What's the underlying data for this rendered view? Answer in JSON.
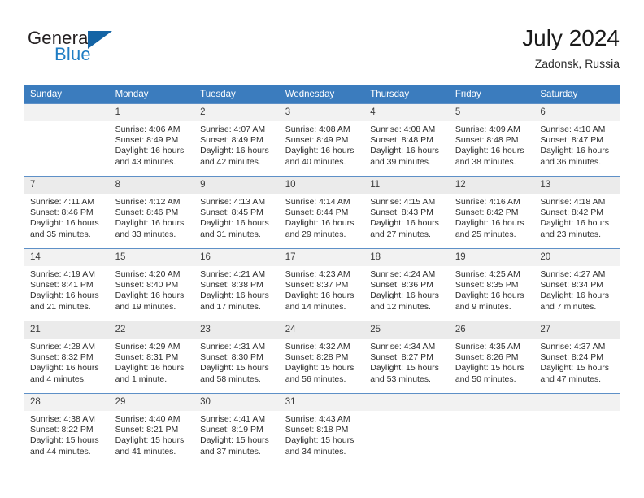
{
  "brand": {
    "word_one": "General",
    "word_two": "Blue",
    "triangle_icon": "triangle-icon",
    "accent_color": "#1464a5"
  },
  "header": {
    "title": "July 2024",
    "subtitle": "Zadonsk, Russia"
  },
  "calendar": {
    "header_color": "#3b7cbe",
    "weekdays": [
      "Sunday",
      "Monday",
      "Tuesday",
      "Wednesday",
      "Thursday",
      "Friday",
      "Saturday"
    ],
    "weeks": [
      [
        {
          "day": "",
          "sunrise": "",
          "sunset": "",
          "daylight_1": "",
          "daylight_2": ""
        },
        {
          "day": "1",
          "sunrise": "Sunrise: 4:06 AM",
          "sunset": "Sunset: 8:49 PM",
          "daylight_1": "Daylight: 16 hours",
          "daylight_2": "and 43 minutes."
        },
        {
          "day": "2",
          "sunrise": "Sunrise: 4:07 AM",
          "sunset": "Sunset: 8:49 PM",
          "daylight_1": "Daylight: 16 hours",
          "daylight_2": "and 42 minutes."
        },
        {
          "day": "3",
          "sunrise": "Sunrise: 4:08 AM",
          "sunset": "Sunset: 8:49 PM",
          "daylight_1": "Daylight: 16 hours",
          "daylight_2": "and 40 minutes."
        },
        {
          "day": "4",
          "sunrise": "Sunrise: 4:08 AM",
          "sunset": "Sunset: 8:48 PM",
          "daylight_1": "Daylight: 16 hours",
          "daylight_2": "and 39 minutes."
        },
        {
          "day": "5",
          "sunrise": "Sunrise: 4:09 AM",
          "sunset": "Sunset: 8:48 PM",
          "daylight_1": "Daylight: 16 hours",
          "daylight_2": "and 38 minutes."
        },
        {
          "day": "6",
          "sunrise": "Sunrise: 4:10 AM",
          "sunset": "Sunset: 8:47 PM",
          "daylight_1": "Daylight: 16 hours",
          "daylight_2": "and 36 minutes."
        }
      ],
      [
        {
          "day": "7",
          "sunrise": "Sunrise: 4:11 AM",
          "sunset": "Sunset: 8:46 PM",
          "daylight_1": "Daylight: 16 hours",
          "daylight_2": "and 35 minutes."
        },
        {
          "day": "8",
          "sunrise": "Sunrise: 4:12 AM",
          "sunset": "Sunset: 8:46 PM",
          "daylight_1": "Daylight: 16 hours",
          "daylight_2": "and 33 minutes."
        },
        {
          "day": "9",
          "sunrise": "Sunrise: 4:13 AM",
          "sunset": "Sunset: 8:45 PM",
          "daylight_1": "Daylight: 16 hours",
          "daylight_2": "and 31 minutes."
        },
        {
          "day": "10",
          "sunrise": "Sunrise: 4:14 AM",
          "sunset": "Sunset: 8:44 PM",
          "daylight_1": "Daylight: 16 hours",
          "daylight_2": "and 29 minutes."
        },
        {
          "day": "11",
          "sunrise": "Sunrise: 4:15 AM",
          "sunset": "Sunset: 8:43 PM",
          "daylight_1": "Daylight: 16 hours",
          "daylight_2": "and 27 minutes."
        },
        {
          "day": "12",
          "sunrise": "Sunrise: 4:16 AM",
          "sunset": "Sunset: 8:42 PM",
          "daylight_1": "Daylight: 16 hours",
          "daylight_2": "and 25 minutes."
        },
        {
          "day": "13",
          "sunrise": "Sunrise: 4:18 AM",
          "sunset": "Sunset: 8:42 PM",
          "daylight_1": "Daylight: 16 hours",
          "daylight_2": "and 23 minutes."
        }
      ],
      [
        {
          "day": "14",
          "sunrise": "Sunrise: 4:19 AM",
          "sunset": "Sunset: 8:41 PM",
          "daylight_1": "Daylight: 16 hours",
          "daylight_2": "and 21 minutes."
        },
        {
          "day": "15",
          "sunrise": "Sunrise: 4:20 AM",
          "sunset": "Sunset: 8:40 PM",
          "daylight_1": "Daylight: 16 hours",
          "daylight_2": "and 19 minutes."
        },
        {
          "day": "16",
          "sunrise": "Sunrise: 4:21 AM",
          "sunset": "Sunset: 8:38 PM",
          "daylight_1": "Daylight: 16 hours",
          "daylight_2": "and 17 minutes."
        },
        {
          "day": "17",
          "sunrise": "Sunrise: 4:23 AM",
          "sunset": "Sunset: 8:37 PM",
          "daylight_1": "Daylight: 16 hours",
          "daylight_2": "and 14 minutes."
        },
        {
          "day": "18",
          "sunrise": "Sunrise: 4:24 AM",
          "sunset": "Sunset: 8:36 PM",
          "daylight_1": "Daylight: 16 hours",
          "daylight_2": "and 12 minutes."
        },
        {
          "day": "19",
          "sunrise": "Sunrise: 4:25 AM",
          "sunset": "Sunset: 8:35 PM",
          "daylight_1": "Daylight: 16 hours",
          "daylight_2": "and 9 minutes."
        },
        {
          "day": "20",
          "sunrise": "Sunrise: 4:27 AM",
          "sunset": "Sunset: 8:34 PM",
          "daylight_1": "Daylight: 16 hours",
          "daylight_2": "and 7 minutes."
        }
      ],
      [
        {
          "day": "21",
          "sunrise": "Sunrise: 4:28 AM",
          "sunset": "Sunset: 8:32 PM",
          "daylight_1": "Daylight: 16 hours",
          "daylight_2": "and 4 minutes."
        },
        {
          "day": "22",
          "sunrise": "Sunrise: 4:29 AM",
          "sunset": "Sunset: 8:31 PM",
          "daylight_1": "Daylight: 16 hours",
          "daylight_2": "and 1 minute."
        },
        {
          "day": "23",
          "sunrise": "Sunrise: 4:31 AM",
          "sunset": "Sunset: 8:30 PM",
          "daylight_1": "Daylight: 15 hours",
          "daylight_2": "and 58 minutes."
        },
        {
          "day": "24",
          "sunrise": "Sunrise: 4:32 AM",
          "sunset": "Sunset: 8:28 PM",
          "daylight_1": "Daylight: 15 hours",
          "daylight_2": "and 56 minutes."
        },
        {
          "day": "25",
          "sunrise": "Sunrise: 4:34 AM",
          "sunset": "Sunset: 8:27 PM",
          "daylight_1": "Daylight: 15 hours",
          "daylight_2": "and 53 minutes."
        },
        {
          "day": "26",
          "sunrise": "Sunrise: 4:35 AM",
          "sunset": "Sunset: 8:26 PM",
          "daylight_1": "Daylight: 15 hours",
          "daylight_2": "and 50 minutes."
        },
        {
          "day": "27",
          "sunrise": "Sunrise: 4:37 AM",
          "sunset": "Sunset: 8:24 PM",
          "daylight_1": "Daylight: 15 hours",
          "daylight_2": "and 47 minutes."
        }
      ],
      [
        {
          "day": "28",
          "sunrise": "Sunrise: 4:38 AM",
          "sunset": "Sunset: 8:22 PM",
          "daylight_1": "Daylight: 15 hours",
          "daylight_2": "and 44 minutes."
        },
        {
          "day": "29",
          "sunrise": "Sunrise: 4:40 AM",
          "sunset": "Sunset: 8:21 PM",
          "daylight_1": "Daylight: 15 hours",
          "daylight_2": "and 41 minutes."
        },
        {
          "day": "30",
          "sunrise": "Sunrise: 4:41 AM",
          "sunset": "Sunset: 8:19 PM",
          "daylight_1": "Daylight: 15 hours",
          "daylight_2": "and 37 minutes."
        },
        {
          "day": "31",
          "sunrise": "Sunrise: 4:43 AM",
          "sunset": "Sunset: 8:18 PM",
          "daylight_1": "Daylight: 15 hours",
          "daylight_2": "and 34 minutes."
        },
        {
          "day": "",
          "sunrise": "",
          "sunset": "",
          "daylight_1": "",
          "daylight_2": ""
        },
        {
          "day": "",
          "sunrise": "",
          "sunset": "",
          "daylight_1": "",
          "daylight_2": ""
        },
        {
          "day": "",
          "sunrise": "",
          "sunset": "",
          "daylight_1": "",
          "daylight_2": ""
        }
      ]
    ]
  }
}
